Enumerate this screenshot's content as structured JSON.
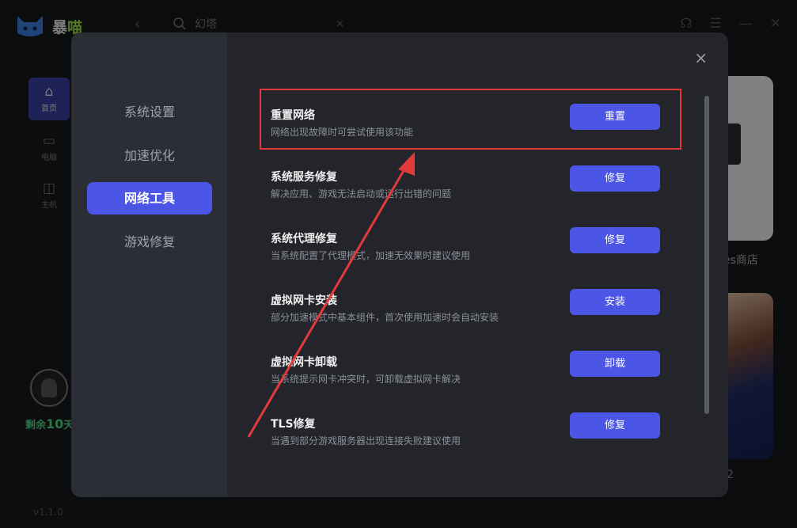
{
  "app": {
    "logo_text_a": "暴",
    "logo_text_b": "喵",
    "search_text": "幻塔",
    "clear_icon": "×",
    "back_icon": "‹",
    "nav": [
      {
        "label": "首页",
        "icon": "home-icon"
      },
      {
        "label": "电脑",
        "icon": "monitor-icon"
      },
      {
        "label": "主机",
        "icon": "gamepad-icon"
      }
    ],
    "remain_prefix": "剩余",
    "remain_days": "10",
    "remain_suffix": "天",
    "version": "v1.1.0",
    "store_text": "es商店",
    "number_text": "2"
  },
  "modal": {
    "tabs": [
      {
        "label": "系统设置",
        "active": false
      },
      {
        "label": "加速优化",
        "active": false
      },
      {
        "label": "网络工具",
        "active": true
      },
      {
        "label": "游戏修复",
        "active": false
      }
    ],
    "close_icon": "×",
    "tools": [
      {
        "title": "重置网络",
        "desc": "网络出现故障时可尝试使用该功能",
        "button": "重置"
      },
      {
        "title": "系统服务修复",
        "desc": "解决应用、游戏无法启动或运行出错的问题",
        "button": "修复"
      },
      {
        "title": "系统代理修复",
        "desc": "当系统配置了代理模式，加速无效果时建议使用",
        "button": "修复"
      },
      {
        "title": "虚拟网卡安装",
        "desc": "部分加速模式中基本组件，首次使用加速时会自动安装",
        "button": "安装"
      },
      {
        "title": "虚拟网卡卸载",
        "desc": "当系统提示网卡冲突时，可卸载虚拟网卡解决",
        "button": "卸载"
      },
      {
        "title": "TLS修复",
        "desc": "当遇到部分游戏服务器出现连接失败建议使用",
        "button": "修复"
      }
    ]
  },
  "colors": {
    "accent": "#4b55e6",
    "highlight": "#e23a3a",
    "remain": "#4fd17c"
  }
}
